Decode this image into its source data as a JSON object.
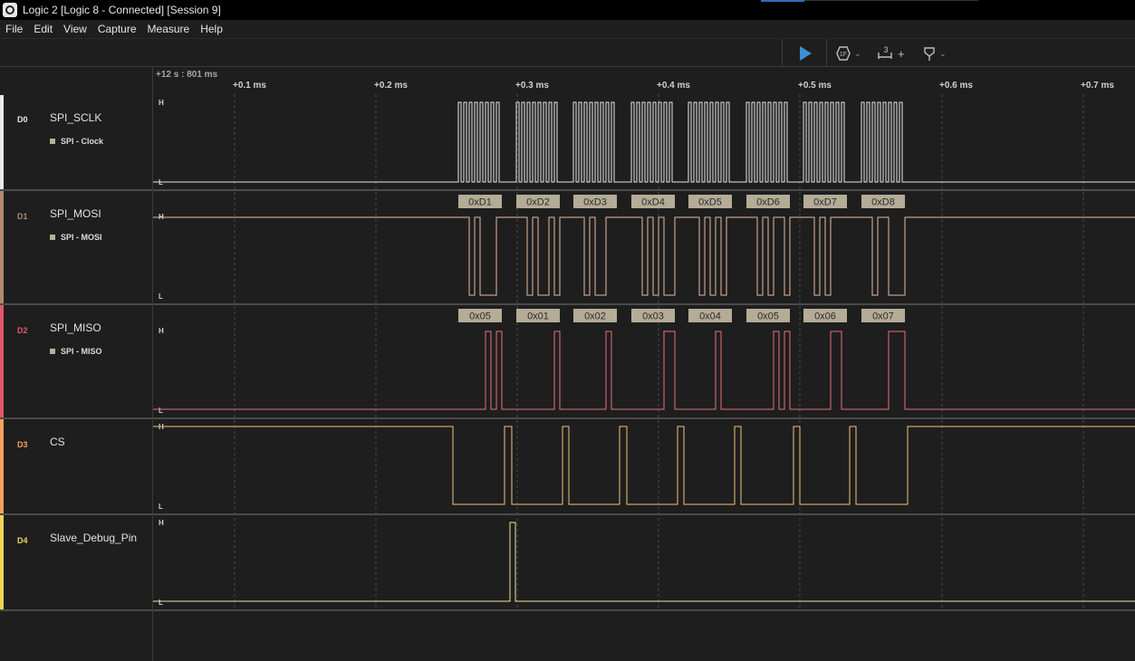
{
  "window": {
    "title": "Logic 2 [Logic 8 - Connected] [Session 9]"
  },
  "menu": [
    "File",
    "Edit",
    "View",
    "Capture",
    "Measure",
    "Help"
  ],
  "toolbar": {
    "play_icon": "play-icon",
    "trigger_label": "1F",
    "timing_label": "3"
  },
  "ruler": {
    "origin": "+12 s : 801 ms",
    "ticks": [
      "+0.1 ms",
      "+0.2 ms",
      "+0.3 ms",
      "+0.4 ms",
      "+0.5 ms",
      "+0.6 ms",
      "+0.7 ms"
    ]
  },
  "channels": [
    {
      "index": "D0",
      "name": "SPI_SCLK",
      "analyzer": "SPI - Clock",
      "color": "#e8e8e8"
    },
    {
      "index": "D1",
      "name": "SPI_MOSI",
      "analyzer": "SPI - MOSI",
      "color": "#b08a6f"
    },
    {
      "index": "D2",
      "name": "SPI_MISO",
      "analyzer": "SPI - MISO",
      "color": "#e0566b"
    },
    {
      "index": "D3",
      "name": "CS",
      "analyzer": "",
      "color": "#f2a15c"
    },
    {
      "index": "D4",
      "name": "Slave_Debug_Pin",
      "analyzer": "",
      "color": "#eed35a"
    }
  ],
  "levels": {
    "high": "H",
    "low": "L"
  },
  "decodes": {
    "mosi": [
      "0xD1",
      "0xD2",
      "0xD3",
      "0xD4",
      "0xD5",
      "0xD6",
      "0xD7",
      "0xD8"
    ],
    "miso": [
      "0x05",
      "0x01",
      "0x02",
      "0x03",
      "0x04",
      "0x05",
      "0x06",
      "0x07"
    ]
  },
  "colors": {
    "sclk_trace": "#e8e8e8",
    "mosi_trace": "#e8b9a4",
    "miso_trace": "#e8707c",
    "cs_trace": "#f2c27a",
    "debug_trace": "#f2e29a",
    "decode_bg": "#b5ac97"
  }
}
